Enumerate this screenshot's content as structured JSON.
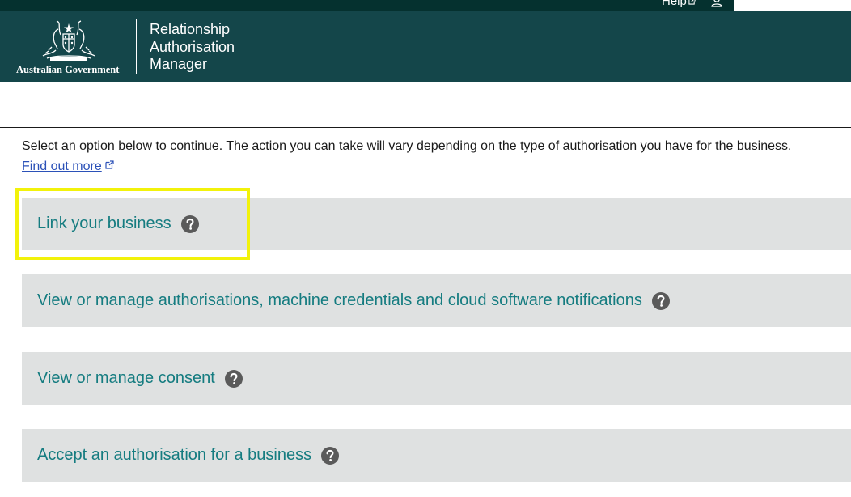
{
  "topbar": {
    "help_label": "Help"
  },
  "header": {
    "gov_label": "Australian Government",
    "app_title_line1": "Relationship",
    "app_title_line2": "Authorisation",
    "app_title_line3": "Manager"
  },
  "main": {
    "intro_text": "Select an option below to continue. The action you can take will vary depending on the type of authorisation you have for the business.",
    "find_out_more": "Find out more"
  },
  "options": [
    {
      "label": "Link your business"
    },
    {
      "label": "View or manage authorisations, machine credentials and cloud software notifications"
    },
    {
      "label": "View or manage consent"
    },
    {
      "label": "Accept an authorisation for a business"
    }
  ],
  "colors": {
    "header_bg": "#14464a",
    "topbar_bg": "#05312f",
    "option_bg": "#dfe1e1",
    "option_text": "#157c80",
    "link": "#2b51b8",
    "highlight": "#f2f20b"
  },
  "icons": {
    "help": "question-circle-icon",
    "external": "external-link-icon",
    "user": "user-icon",
    "crest": "coat-of-arms-icon"
  }
}
